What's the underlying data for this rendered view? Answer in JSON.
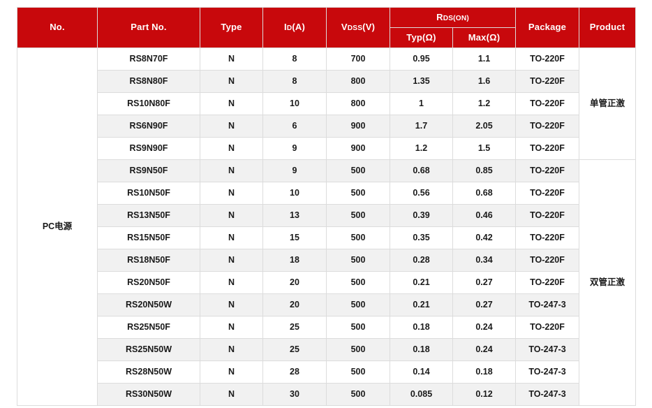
{
  "table": {
    "header": {
      "no": "No.",
      "part_no": "Part No.",
      "type": "Type",
      "id_main": "I",
      "id_sub": "D",
      "id_unit": "(A)",
      "vdss_main": "V",
      "vdss_sub": "DSS",
      "vdss_unit": "(V)",
      "rdson_main": "R",
      "rdson_sub": "DS(ON)",
      "typ": "Typ(Ω)",
      "max": "Max(Ω)",
      "package": "Package",
      "product": "Product"
    },
    "no_label": "PC电源",
    "groups": [
      {
        "label": "单管正激",
        "rows": 5
      },
      {
        "label": "双管正激",
        "rows": 11
      }
    ],
    "rows": [
      {
        "part_no": "RS8N70F",
        "type": "N",
        "id": "8",
        "vdss": "700",
        "typ": "0.95",
        "max": "1.1",
        "package": "TO-220F"
      },
      {
        "part_no": "RS8N80F",
        "type": "N",
        "id": "8",
        "vdss": "800",
        "typ": "1.35",
        "max": "1.6",
        "package": "TO-220F"
      },
      {
        "part_no": "RS10N80F",
        "type": "N",
        "id": "10",
        "vdss": "800",
        "typ": "1",
        "max": "1.2",
        "package": "TO-220F"
      },
      {
        "part_no": "RS6N90F",
        "type": "N",
        "id": "6",
        "vdss": "900",
        "typ": "1.7",
        "max": "2.05",
        "package": "TO-220F"
      },
      {
        "part_no": "RS9N90F",
        "type": "N",
        "id": "9",
        "vdss": "900",
        "typ": "1.2",
        "max": "1.5",
        "package": "TO-220F"
      },
      {
        "part_no": "RS9N50F",
        "type": "N",
        "id": "9",
        "vdss": "500",
        "typ": "0.68",
        "max": "0.85",
        "package": "TO-220F"
      },
      {
        "part_no": "RS10N50F",
        "type": "N",
        "id": "10",
        "vdss": "500",
        "typ": "0.56",
        "max": "0.68",
        "package": "TO-220F"
      },
      {
        "part_no": "RS13N50F",
        "type": "N",
        "id": "13",
        "vdss": "500",
        "typ": "0.39",
        "max": "0.46",
        "package": "TO-220F"
      },
      {
        "part_no": "RS15N50F",
        "type": "N",
        "id": "15",
        "vdss": "500",
        "typ": "0.35",
        "max": "0.42",
        "package": "TO-220F"
      },
      {
        "part_no": "RS18N50F",
        "type": "N",
        "id": "18",
        "vdss": "500",
        "typ": "0.28",
        "max": "0.34",
        "package": "TO-220F"
      },
      {
        "part_no": "RS20N50F",
        "type": "N",
        "id": "20",
        "vdss": "500",
        "typ": "0.21",
        "max": "0.27",
        "package": "TO-220F"
      },
      {
        "part_no": "RS20N50W",
        "type": "N",
        "id": "20",
        "vdss": "500",
        "typ": "0.21",
        "max": "0.27",
        "package": "TO-247-3"
      },
      {
        "part_no": "RS25N50F",
        "type": "N",
        "id": "25",
        "vdss": "500",
        "typ": "0.18",
        "max": "0.24",
        "package": "TO-220F"
      },
      {
        "part_no": "RS25N50W",
        "type": "N",
        "id": "25",
        "vdss": "500",
        "typ": "0.18",
        "max": "0.24",
        "package": "TO-247-3"
      },
      {
        "part_no": "RS28N50W",
        "type": "N",
        "id": "28",
        "vdss": "500",
        "typ": "0.14",
        "max": "0.18",
        "package": "TO-247-3"
      },
      {
        "part_no": "RS30N50W",
        "type": "N",
        "id": "30",
        "vdss": "500",
        "typ": "0.085",
        "max": "0.12",
        "package": "TO-247-3"
      }
    ]
  },
  "colors": {
    "header_red": "#c8080c",
    "row_alt": "#f1f1f1",
    "row_base": "#ffffff",
    "border": "#dcdcdc",
    "text": "#1a1a1a"
  }
}
